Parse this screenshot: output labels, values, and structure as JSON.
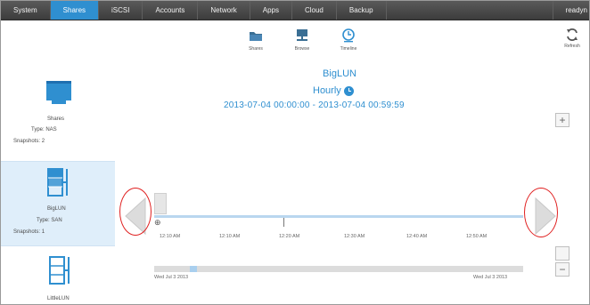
{
  "nav": {
    "items": [
      "System",
      "Shares",
      "iSCSI",
      "Accounts",
      "Network",
      "Apps",
      "Cloud",
      "Backup"
    ],
    "active_index": 1,
    "right_label": "readyn"
  },
  "toolbar": {
    "items": [
      {
        "label": "Shares",
        "icon": "folder-icon"
      },
      {
        "label": "Browse",
        "icon": "browse-icon"
      },
      {
        "label": "Timeline",
        "icon": "clock-icon"
      }
    ],
    "refresh_label": "Refresh"
  },
  "volumes": [
    {
      "name": "Shares",
      "type": "Type: NAS",
      "snapshots": "Snapshots: 2"
    },
    {
      "name": "BigLUN",
      "type": "Type: SAN",
      "snapshots": "Snapshots: 1"
    },
    {
      "name": "LittleLUN",
      "type": "",
      "snapshots": ""
    }
  ],
  "detail": {
    "title": "BigLUN",
    "frequency": "Hourly",
    "range": "2013-07-04 00:00:00 - 2013-07-04 00:59:59"
  },
  "timeline": {
    "labels": [
      "12:10 AM",
      "12:10 AM",
      "12:20 AM",
      "12:30 AM",
      "12:40 AM",
      "12:50 AM"
    ],
    "start_date": "Wed Jul 3 2013",
    "end_date": "Wed Jul 3 2013"
  },
  "buttons": {
    "zoom_in": "+",
    "zoom_out": "−"
  },
  "colors": {
    "accent": "#2f8fd0",
    "annotation": "#e02020"
  }
}
